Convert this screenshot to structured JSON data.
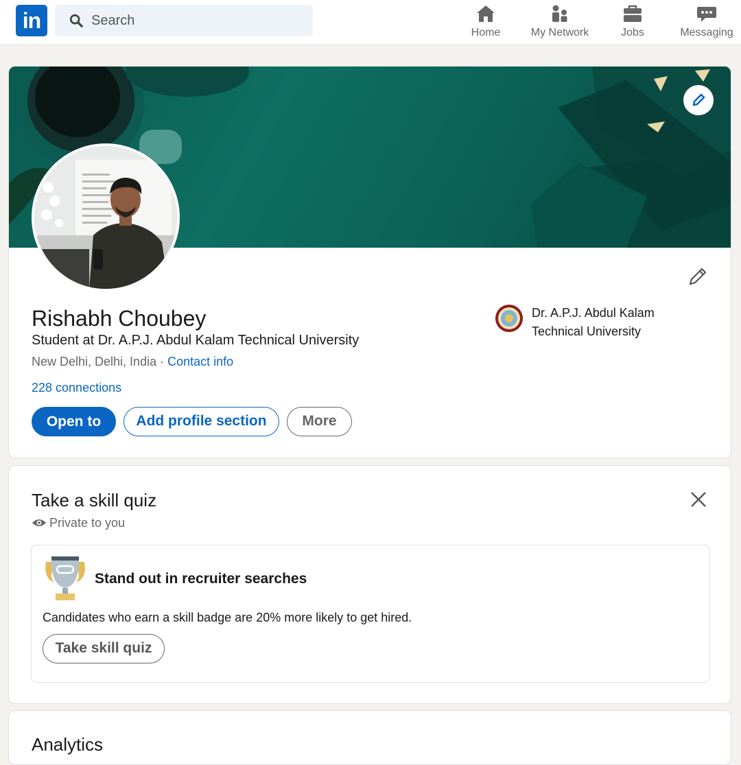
{
  "nav": {
    "logo_text": "in",
    "search_placeholder": "Search",
    "items": [
      {
        "label": "Home",
        "icon": "home-icon"
      },
      {
        "label": "My Network",
        "icon": "network-icon"
      },
      {
        "label": "Jobs",
        "icon": "briefcase-icon"
      },
      {
        "label": "Messaging",
        "icon": "message-icon"
      }
    ]
  },
  "profile": {
    "name": "Rishabh Choubey",
    "headline": "Student at Dr. A.P.J. Abdul Kalam Technical University",
    "location": "New Delhi, Delhi, India",
    "location_separator": " · ",
    "contact_info": "Contact info",
    "connections": "228 connections",
    "buttons": {
      "open_to": "Open to",
      "add_section": "Add profile section",
      "more": "More"
    },
    "school_line1": "Dr. A.P.J. Abdul Kalam",
    "school_line2": "Technical University"
  },
  "skill_quiz": {
    "title": "Take a skill quiz",
    "private": "Private to you",
    "card_title": "Stand out in recruiter searches",
    "card_desc": "Candidates who earn a skill badge are 20% more likely to get hired.",
    "button": "Take skill quiz"
  },
  "analytics": {
    "title": "Analytics"
  },
  "colors": {
    "brand": "#0a66c2",
    "banner": "#0e6e62",
    "background": "#f4f2ee"
  }
}
